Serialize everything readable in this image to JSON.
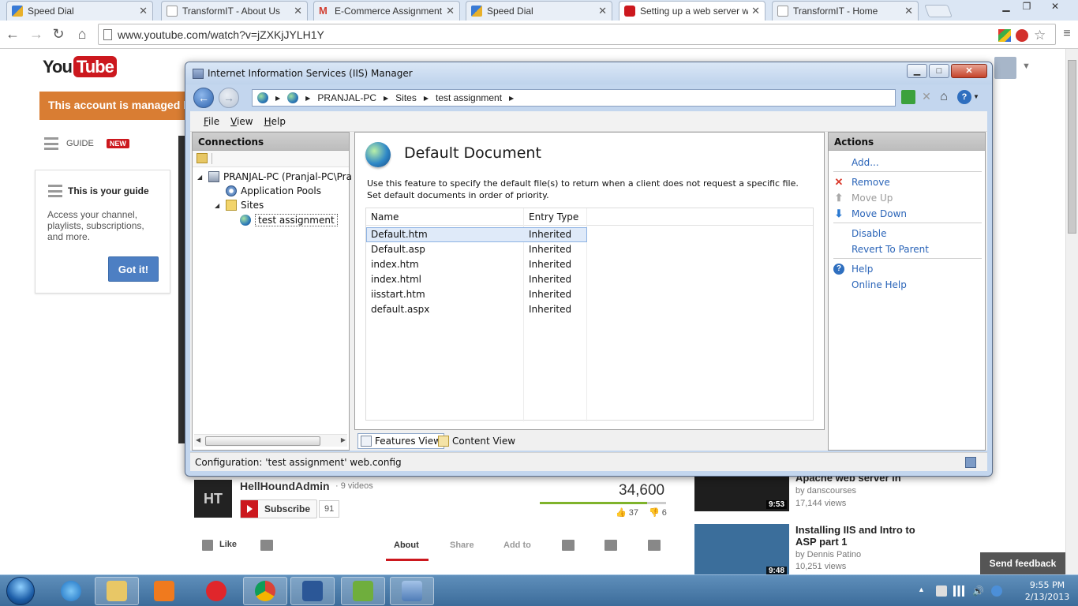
{
  "browser": {
    "tabs": [
      {
        "label": "Speed Dial",
        "favicon": "speed-dial-icon"
      },
      {
        "label": "TransformIT - About Us",
        "favicon": "page-icon"
      },
      {
        "label": "E-Commerce Assignment",
        "favicon": "gmail-icon"
      },
      {
        "label": "Speed Dial",
        "favicon": "speed-dial-icon"
      },
      {
        "label": "Setting up a web server wi",
        "favicon": "youtube-icon",
        "active": true
      },
      {
        "label": "TransformIT - Home",
        "favicon": "page-icon"
      }
    ],
    "url": "www.youtube.com/watch?v=jZXKjJYLH1Y"
  },
  "youtube": {
    "logo_you": "You",
    "logo_tube": "Tube",
    "managed_banner": "This account is managed by",
    "guide_label": "GUIDE",
    "new_badge": "NEW",
    "guide_card": {
      "title": "This is your guide",
      "body": "Access your channel, playlists, subscriptions, and more.",
      "button": "Got it!"
    },
    "channel": {
      "avatar_text": "HT",
      "name": "HellHoundAdmin",
      "videos": "· 9 videos",
      "subscribe": "Subscribe",
      "subscribers": "91"
    },
    "views": "34,600",
    "likes": "37",
    "dislikes": "6",
    "actions": {
      "like": "Like",
      "about": "About",
      "share": "Share",
      "add_to": "Add to"
    },
    "related": [
      {
        "title": "Apache web server in",
        "author": "by danscourses",
        "views": "17,144 views",
        "duration": "9:53"
      },
      {
        "title": "Installing IIS and Intro to ASP part 1",
        "author": "by Dennis Patino",
        "views": "10,251 views",
        "duration": "9:48"
      }
    ],
    "send_feedback": "Send feedback"
  },
  "iis": {
    "title": "Internet Information Services (IIS) Manager",
    "breadcrumb": [
      "PRANJAL-PC",
      "Sites",
      "test assignment"
    ],
    "menu": [
      {
        "label": "File",
        "key": "F",
        "rest": "ile"
      },
      {
        "label": "View",
        "key": "V",
        "rest": "iew"
      },
      {
        "label": "Help",
        "key": "H",
        "rest": "elp"
      }
    ],
    "connections": {
      "header": "Connections",
      "tree": {
        "server": "PRANJAL-PC (Pranjal-PC\\Pra",
        "app_pools": "Application Pools",
        "sites": "Sites",
        "site": "test assignment"
      }
    },
    "feature": {
      "title": "Default Document",
      "description": "Use this feature to specify the default file(s) to return when a client does not request a specific file. Set default documents in order of priority.",
      "columns": [
        "Name",
        "Entry Type"
      ],
      "rows": [
        {
          "name": "Default.htm",
          "type": "Inherited",
          "selected": true
        },
        {
          "name": "Default.asp",
          "type": "Inherited"
        },
        {
          "name": "index.htm",
          "type": "Inherited"
        },
        {
          "name": "index.html",
          "type": "Inherited"
        },
        {
          "name": "iisstart.htm",
          "type": "Inherited"
        },
        {
          "name": "default.aspx",
          "type": "Inherited"
        }
      ],
      "view_tabs": {
        "features": "Features View",
        "content": "Content View"
      }
    },
    "actions": {
      "header": "Actions",
      "add": "Add...",
      "remove": "Remove",
      "move_up": "Move Up",
      "move_down": "Move Down",
      "disable": "Disable",
      "revert": "Revert To Parent",
      "help": "Help",
      "online_help": "Online Help"
    },
    "status": "Configuration: 'test assignment' web.config"
  },
  "taskbar": {
    "time": "9:55 PM",
    "date": "2/13/2013",
    "apps": [
      "internet-explorer-icon",
      "file-explorer-icon",
      "media-player-icon",
      "opera-icon",
      "chrome-icon",
      "word-icon",
      "lync-icon",
      "iis-manager-icon"
    ]
  },
  "colors": {
    "youtube_red": "#cc181e",
    "managed_banner": "#d97d33",
    "link_blue": "#2a64b8",
    "remove_red": "#d9382a",
    "move_down_blue": "#2b79d1"
  }
}
